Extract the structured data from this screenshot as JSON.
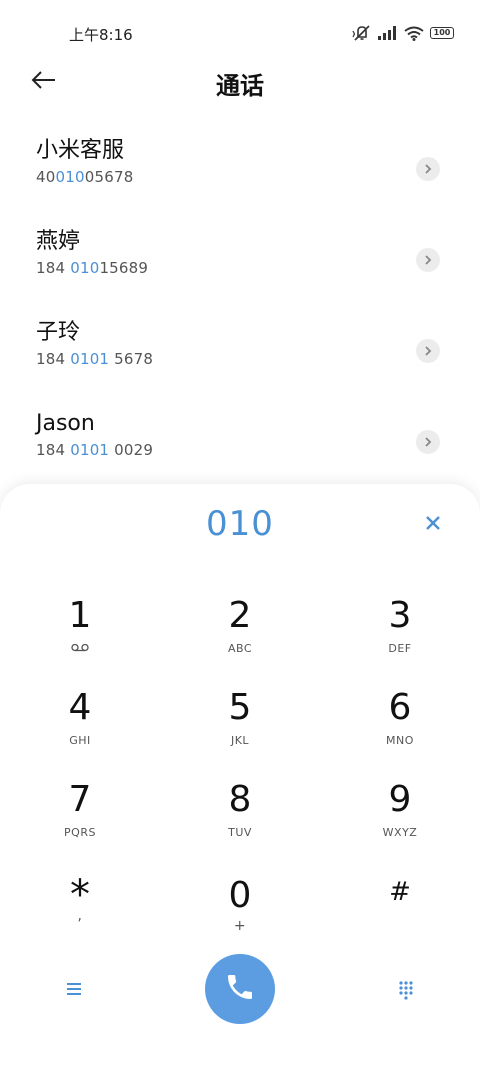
{
  "status_bar": {
    "time": "上午8:16",
    "battery": "100"
  },
  "header": {
    "title": "通话"
  },
  "contacts": [
    {
      "name": "小米客服",
      "number_pre": "40",
      "number_hl": "010",
      "number_post": "05678"
    },
    {
      "name": "燕婷",
      "number_pre": "184 ",
      "number_hl": "010",
      "number_post": "15689"
    },
    {
      "name": "子玲",
      "number_pre": "184 ",
      "number_hl": "0101",
      "number_post": " 5678"
    },
    {
      "name": "Jason",
      "number_pre": "184 ",
      "number_hl": "0101",
      "number_post": " 0029"
    }
  ],
  "dialpad": {
    "entered": "010",
    "keys": [
      [
        {
          "digit": "1",
          "letters": ""
        },
        {
          "digit": "2",
          "letters": "ABC"
        },
        {
          "digit": "3",
          "letters": "DEF"
        }
      ],
      [
        {
          "digit": "4",
          "letters": "GHI"
        },
        {
          "digit": "5",
          "letters": "JKL"
        },
        {
          "digit": "6",
          "letters": "MNO"
        }
      ],
      [
        {
          "digit": "7",
          "letters": "PQRS"
        },
        {
          "digit": "8",
          "letters": "TUV"
        },
        {
          "digit": "9",
          "letters": "WXYZ"
        }
      ],
      [
        {
          "digit": "*",
          "letters": ","
        },
        {
          "digit": "0",
          "letters": "+"
        },
        {
          "digit": "#",
          "letters": ""
        }
      ]
    ]
  },
  "colors": {
    "accent": "#4a90d4",
    "call_button": "#5b9de0"
  },
  "icons": {
    "back": "arrow-left-icon",
    "contact_action": "chevron-right-icon",
    "clear": "close-icon",
    "voicemail": "voicemail-icon",
    "menu": "menu-icon",
    "call": "phone-icon",
    "keypad": "dialpad-icon"
  }
}
